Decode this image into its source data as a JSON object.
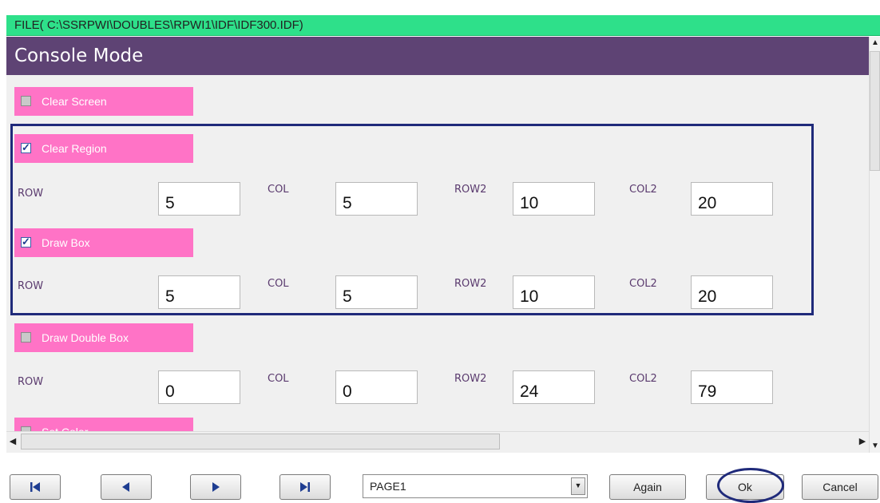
{
  "window": {
    "file_path": "FILE( C:\\SSRPWI\\DOUBLES\\RPWI1\\IDF\\IDF300.IDF)",
    "title": "Console Mode"
  },
  "options": {
    "clear_screen": {
      "label": "Clear Screen",
      "checked": false
    },
    "clear_region": {
      "label": "Clear Region",
      "checked": true,
      "row_label": "ROW",
      "col_label": "COL",
      "row2_label": "ROW2",
      "col2_label": "COL2",
      "row": "5",
      "col": "5",
      "row2": "10",
      "col2": "20"
    },
    "draw_box": {
      "label": "Draw Box",
      "checked": true,
      "row_label": "ROW",
      "col_label": "COL",
      "row2_label": "ROW2",
      "col2_label": "COL2",
      "row": "5",
      "col": "5",
      "row2": "10",
      "col2": "20"
    },
    "draw_double_box": {
      "label": "Draw Double Box",
      "checked": false,
      "row_label": "ROW",
      "col_label": "COL",
      "row2_label": "ROW2",
      "col2_label": "COL2",
      "row": "0",
      "col": "0",
      "row2": "24",
      "col2": "79"
    },
    "set_color": {
      "label": "Set Color",
      "checked": false
    }
  },
  "footer": {
    "page_select": "PAGE1",
    "again_label": "Again",
    "ok_label": "Ok",
    "cancel_label": "Cancel"
  },
  "icons": {
    "first": "first-page-icon",
    "prev": "previous-page-icon",
    "next": "next-page-icon",
    "last": "last-page-icon"
  },
  "colors": {
    "titlebar": "#2ee08a",
    "header": "#5e4374",
    "option_bar": "#ff73c6",
    "highlight": "#1f2a7a"
  }
}
